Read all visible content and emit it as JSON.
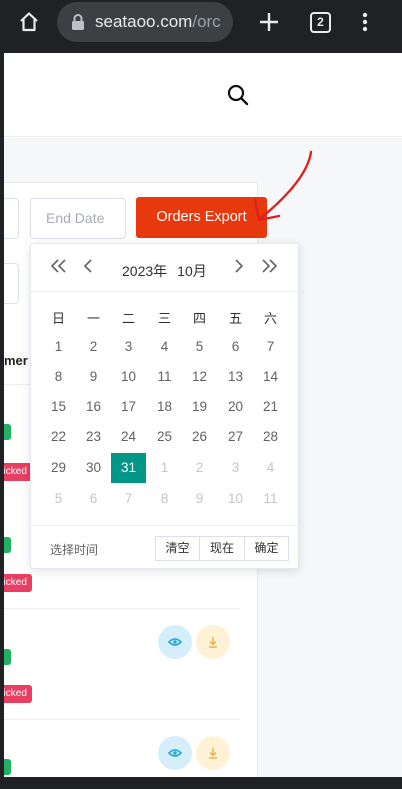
{
  "browser": {
    "url_domain": "seataoo.com",
    "url_rest": "/orc",
    "tab_count": "2"
  },
  "filters": {
    "end_date_placeholder": "End Date",
    "export_label": "Orders Export"
  },
  "table": {
    "partial_header": "mer",
    "status_tag": "picked"
  },
  "date_picker": {
    "year_label": "2023年",
    "month_label": "10月",
    "weekdays": [
      "日",
      "一",
      "二",
      "三",
      "四",
      "五",
      "六"
    ],
    "days": [
      [
        "1",
        "2",
        "3",
        "4",
        "5",
        "6",
        "7"
      ],
      [
        "8",
        "9",
        "10",
        "11",
        "12",
        "13",
        "14"
      ],
      [
        "15",
        "16",
        "17",
        "18",
        "19",
        "20",
        "21"
      ],
      [
        "22",
        "23",
        "24",
        "25",
        "26",
        "27",
        "28"
      ],
      [
        "29",
        "30",
        "31",
        "1",
        "2",
        "3",
        "4"
      ],
      [
        "5",
        "6",
        "7",
        "8",
        "9",
        "10",
        "11"
      ]
    ],
    "selected_day": "31",
    "footer_label": "选择时间",
    "clear_label": "清空",
    "now_label": "现在",
    "confirm_label": "确定"
  },
  "colors": {
    "export_button": "#e8380d",
    "selected_day": "#009688",
    "annotation_arrow": "#e02020"
  }
}
